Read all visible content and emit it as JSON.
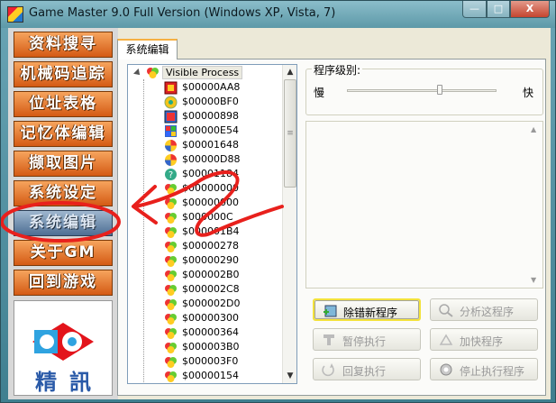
{
  "window": {
    "title": "Game Master 9.0 Full Version (Windows XP, Vista, 7)",
    "controls": {
      "minimize": "—",
      "maximize": "□",
      "close": "X"
    }
  },
  "sidebar": {
    "items": [
      {
        "label": "资料搜寻"
      },
      {
        "label": "机械码追踪"
      },
      {
        "label": "位址表格"
      },
      {
        "label": "记忆体编辑"
      },
      {
        "label": "撷取图片"
      },
      {
        "label": "系统设定"
      },
      {
        "label": "系统编辑",
        "active": true
      },
      {
        "label": "关于GM"
      },
      {
        "label": "回到游戏"
      }
    ],
    "logo_text": "精訊"
  },
  "tabs": [
    {
      "label": "系统编辑"
    }
  ],
  "tree": {
    "root_label": "Visible Process",
    "processes": [
      {
        "id": "$00000AA8",
        "icon": "app-icon-red"
      },
      {
        "id": "$00000BF0",
        "icon": "gear-icon"
      },
      {
        "id": "$00000898",
        "icon": "app-icon-blue"
      },
      {
        "id": "$00000E54",
        "icon": "windows-icon"
      },
      {
        "id": "$00001648",
        "icon": "colorball-icon"
      },
      {
        "id": "$00000D88",
        "icon": "colorball-icon"
      },
      {
        "id": "$00001184",
        "icon": "help-icon"
      },
      {
        "id": "$00000000",
        "icon": "process-icon"
      },
      {
        "id": "$00000000",
        "icon": "process-icon"
      },
      {
        "id": "$000000C",
        "icon": "process-icon"
      },
      {
        "id": "$000001B4",
        "icon": "process-icon"
      },
      {
        "id": "$00000278",
        "icon": "process-icon"
      },
      {
        "id": "$00000290",
        "icon": "process-icon"
      },
      {
        "id": "$000002B0",
        "icon": "process-icon"
      },
      {
        "id": "$000002C8",
        "icon": "process-icon"
      },
      {
        "id": "$000002D0",
        "icon": "process-icon"
      },
      {
        "id": "$00000300",
        "icon": "process-icon"
      },
      {
        "id": "$00000364",
        "icon": "process-icon"
      },
      {
        "id": "$000003B0",
        "icon": "process-icon"
      },
      {
        "id": "$000003F0",
        "icon": "process-icon"
      },
      {
        "id": "$00000154",
        "icon": "process-icon"
      }
    ]
  },
  "priority": {
    "label": "程序级别:",
    "slow": "慢",
    "fast": "快",
    "level": 0.62
  },
  "buttons": {
    "remove": "除错新程序",
    "analyze": "分析这程序",
    "pause": "暂停执行",
    "speedup": "加快程序",
    "resume": "回复执行",
    "stop": "停止执行程序"
  },
  "colors": {
    "accent_orange": "#d45a14",
    "active_blue": "#4d6e93",
    "annotation_red": "#e8201c",
    "focus_yellow": "#f3e23c"
  }
}
